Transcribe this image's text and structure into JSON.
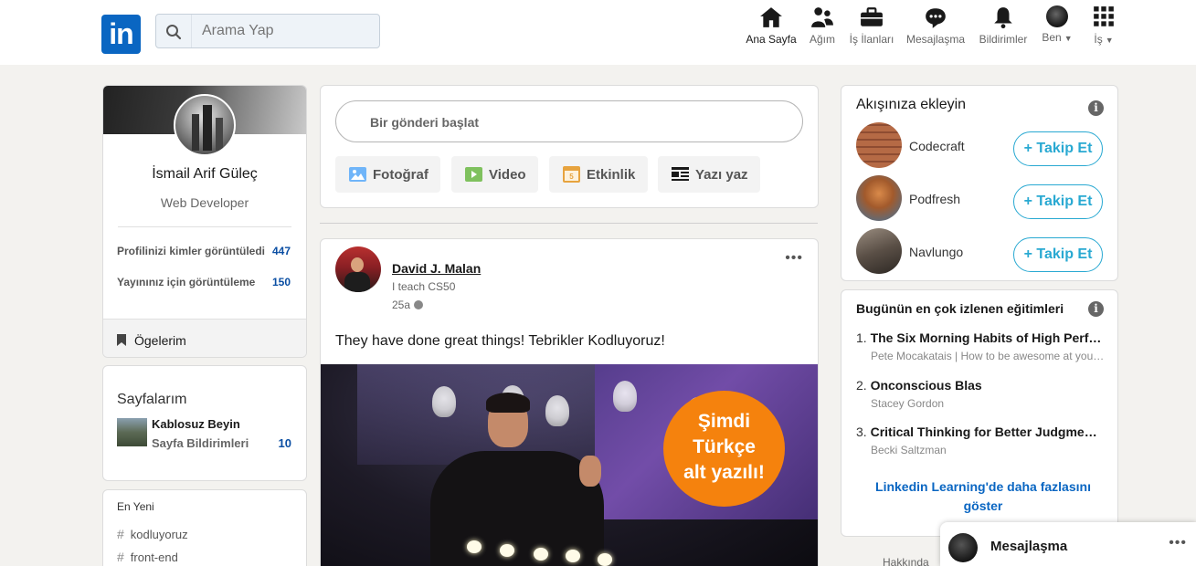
{
  "header": {
    "logo": "in",
    "search_placeholder": "Arama Yap",
    "nav": [
      {
        "label": "Ana Sayfa",
        "icon": "home-icon"
      },
      {
        "label": "Ağım",
        "icon": "network-icon"
      },
      {
        "label": "İş İlanları",
        "icon": "briefcase-icon"
      },
      {
        "label": "Mesajlaşma",
        "icon": "chat-icon"
      },
      {
        "label": "Bildirimler",
        "icon": "bell-icon"
      },
      {
        "label": "Ben",
        "icon": "avatar"
      },
      {
        "label": "İş",
        "icon": "grid-icon"
      }
    ]
  },
  "profile": {
    "name": "İsmail Arif Güleç",
    "title": "Web Developer",
    "stats": [
      {
        "label": "Profilinizi kimler görüntüledi",
        "value": "447"
      },
      {
        "label": "Yayınınız için görüntüleme",
        "value": "150"
      }
    ],
    "items_label": "Ögelerim"
  },
  "pages": {
    "title": "Sayfalarım",
    "page_name": "Kablosuz Beyin",
    "page_sub": "Sayfa Bildirimleri",
    "page_count": "10"
  },
  "recent": {
    "title": "En Yeni",
    "tags": [
      "kodluyoruz",
      "front-end"
    ]
  },
  "composer": {
    "placeholder": "Bir gönderi başlat",
    "buttons": [
      {
        "label": "Fotoğraf",
        "icon": "photo-icon",
        "color": "#70b5f9"
      },
      {
        "label": "Video",
        "icon": "video-icon",
        "color": "#7fc15e"
      },
      {
        "label": "Etkinlik",
        "icon": "calendar-icon",
        "color": "#e7a33e"
      },
      {
        "label": "Yazı yaz",
        "icon": "article-icon",
        "color": "#191919"
      }
    ]
  },
  "post": {
    "author": "David J. Malan",
    "headline": "I teach CS50",
    "time": "25a",
    "text": "They have done great things! Tebrikler Kodluyoruz!",
    "badge_lines": [
      "Şimdi",
      "Türkçe",
      "alt yazılı!"
    ]
  },
  "follow": {
    "title": "Akışınıza ekleyin",
    "button_label": "+ Takip Et",
    "items": [
      {
        "name": "Codecraft"
      },
      {
        "name": "Podfresh"
      },
      {
        "name": "Navlungo"
      }
    ]
  },
  "learning": {
    "title": "Bugünün en çok izlenen eğitimleri",
    "courses": [
      {
        "num": "1.",
        "title": "The Six Morning Habits of High Perf…",
        "sub": "Pete Mocakatais | How to be awesome at you…"
      },
      {
        "num": "2.",
        "title": "Onconscious Blas",
        "sub": "Stacey Gordon"
      },
      {
        "num": "3.",
        "title": "Critical Thinking for Better Judgme…",
        "sub": "Becki Saltzman"
      }
    ],
    "more": "Linkedin Learning'de daha fazlasını göster"
  },
  "footer": {
    "about": "Hakkında"
  },
  "messaging": {
    "label": "Mesajlaşma"
  },
  "colors": {
    "brand": "#0a66c2",
    "follow": "#29a9d2",
    "badge": "#f5820d"
  }
}
